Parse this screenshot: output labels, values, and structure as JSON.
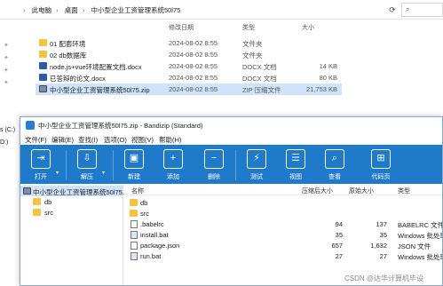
{
  "explorer": {
    "breadcrumb": [
      "此电脑",
      "桌面",
      "中小型企业工资管理系统50l75"
    ],
    "columns": {
      "modified": "修改日期",
      "type": "类型",
      "size": "大小"
    },
    "rows": [
      {
        "name": "01 配套环境",
        "modified": "2024-08-02 8:55",
        "type": "文件夹",
        "size": "",
        "icon": "folder-icon"
      },
      {
        "name": "02 db数据库",
        "modified": "2024-08-02 8:55",
        "type": "文件夹",
        "size": "",
        "icon": "folder-icon"
      },
      {
        "name": "node.js+vue环境配置文档.docx",
        "modified": "2024-08-02 8:55",
        "type": "DOCX 文档",
        "size": "14 KB",
        "icon": "docx-icon"
      },
      {
        "name": "已答辩的论文.docx",
        "modified": "2024-08-02 8:55",
        "type": "DOCX 文档",
        "size": "80 KB",
        "icon": "docx-icon"
      },
      {
        "name": "中小型企业工资管理系统50l75.zip",
        "modified": "2024-08-02 8:55",
        "type": "ZIP 压缩文件",
        "size": "21,753 KB",
        "icon": "zip-icon"
      }
    ],
    "side_labels": [
      "s (C:)",
      "D:)"
    ],
    "right_label": "设"
  },
  "bandizip": {
    "title": "中小型企业工资管理系统50l75.zip - Bandizip (Standard)",
    "menu": [
      "文件(F)",
      "编辑(E)",
      "查找(I)",
      "选项(O)",
      "视图(V)",
      "帮助(H)"
    ],
    "toolbar": [
      {
        "label": "打开",
        "icon": "open-icon",
        "glyph": "⇥"
      },
      {
        "label": "解压",
        "icon": "extract-icon",
        "glyph": "⇩"
      },
      {
        "label": "新建",
        "icon": "new-archive-icon",
        "glyph": "▣"
      },
      {
        "label": "添加",
        "icon": "add-icon",
        "glyph": "+"
      },
      {
        "label": "删除",
        "icon": "delete-icon",
        "glyph": "−"
      },
      {
        "label": "测试",
        "icon": "test-icon",
        "glyph": "⚡"
      },
      {
        "label": "视图",
        "icon": "view-icon",
        "glyph": "☰"
      },
      {
        "label": "查看",
        "icon": "view-search-icon",
        "glyph": "⌕"
      },
      {
        "label": "代码页",
        "icon": "codepage-icon",
        "glyph": "⊞"
      }
    ],
    "tree": [
      {
        "name": "中小型企业工资管理系统50l75.zip",
        "icon": "zip-icon"
      },
      {
        "name": "db",
        "icon": "folder-icon"
      },
      {
        "name": "src",
        "icon": "folder-icon"
      }
    ],
    "columns": {
      "name": "名称",
      "packed": "压缩后大小",
      "original": "原始大小",
      "type": "类型"
    },
    "files": [
      {
        "name": "db",
        "packed": "",
        "original": "",
        "type": "",
        "icon": "folder-icon"
      },
      {
        "name": "src",
        "packed": "",
        "original": "",
        "type": "",
        "icon": "folder-icon"
      },
      {
        "name": ".babelrc",
        "packed": "94",
        "original": "137",
        "type": "BABELRC 文件",
        "icon": "file-icon"
      },
      {
        "name": "install.bat",
        "packed": "35",
        "original": "35",
        "type": "Windows 批处理",
        "icon": "bat-icon"
      },
      {
        "name": "package.json",
        "packed": "657",
        "original": "1,632",
        "type": "JSON 文件",
        "icon": "file-icon"
      },
      {
        "name": "run.bat",
        "packed": "27",
        "original": "27",
        "type": "Windows 批处理",
        "icon": "bat-icon"
      }
    ]
  },
  "watermark": "CSDN @达华计算机毕设"
}
